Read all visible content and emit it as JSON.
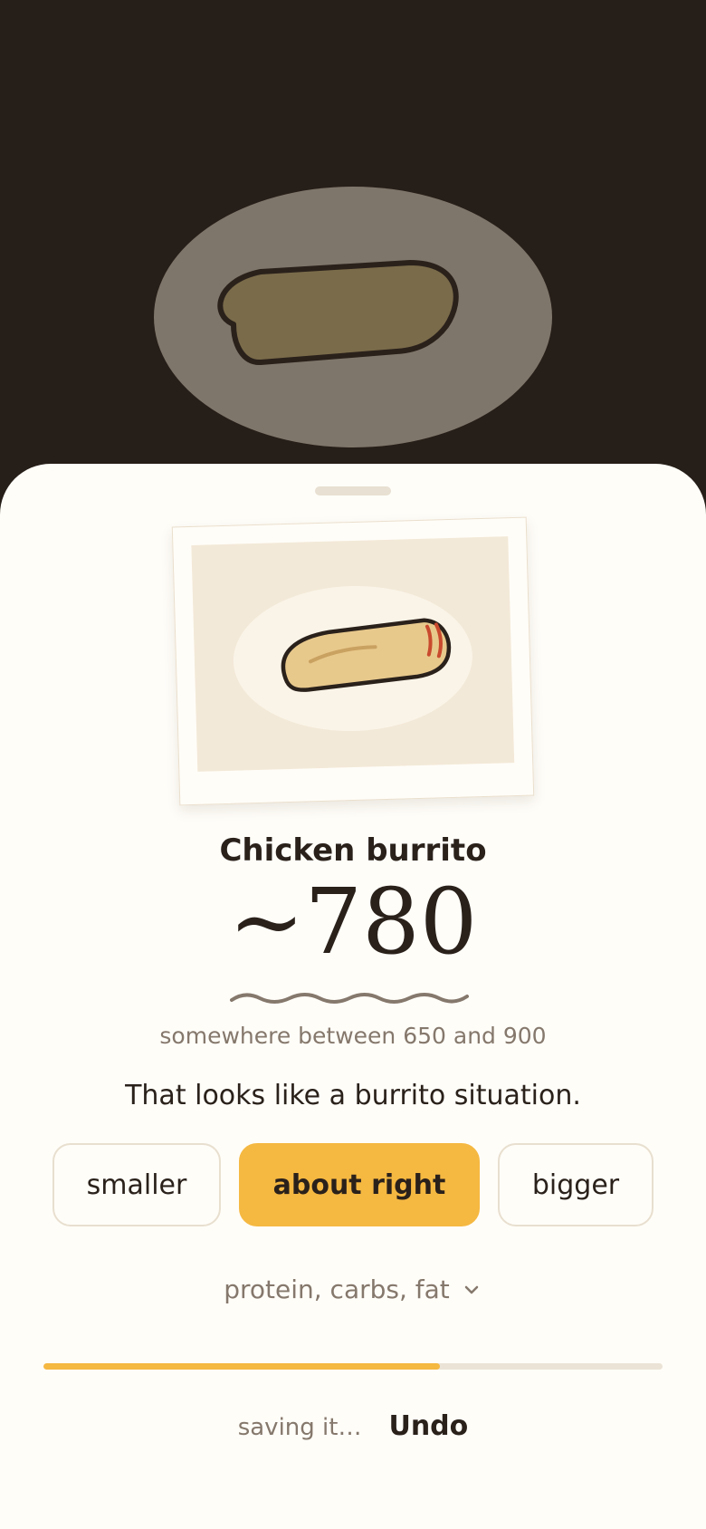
{
  "food": {
    "name": "Chicken burrito",
    "calories_display": "~780",
    "range_text": "somewhere between 650 and 900",
    "quip": "That looks like a burrito situation."
  },
  "portion": {
    "options": [
      "smaller",
      "about right",
      "bigger"
    ],
    "selected": "about right"
  },
  "macros": {
    "label": "protein, carbs, fat",
    "icon": "chevron-down-icon"
  },
  "save": {
    "progress": 0.64,
    "status": "saving it…",
    "undo_label": "Undo"
  },
  "colors": {
    "accent": "#f5b841",
    "background": "#261e18",
    "sheet": "#fffdf8",
    "text": "#2a211b",
    "muted": "#85786c"
  }
}
